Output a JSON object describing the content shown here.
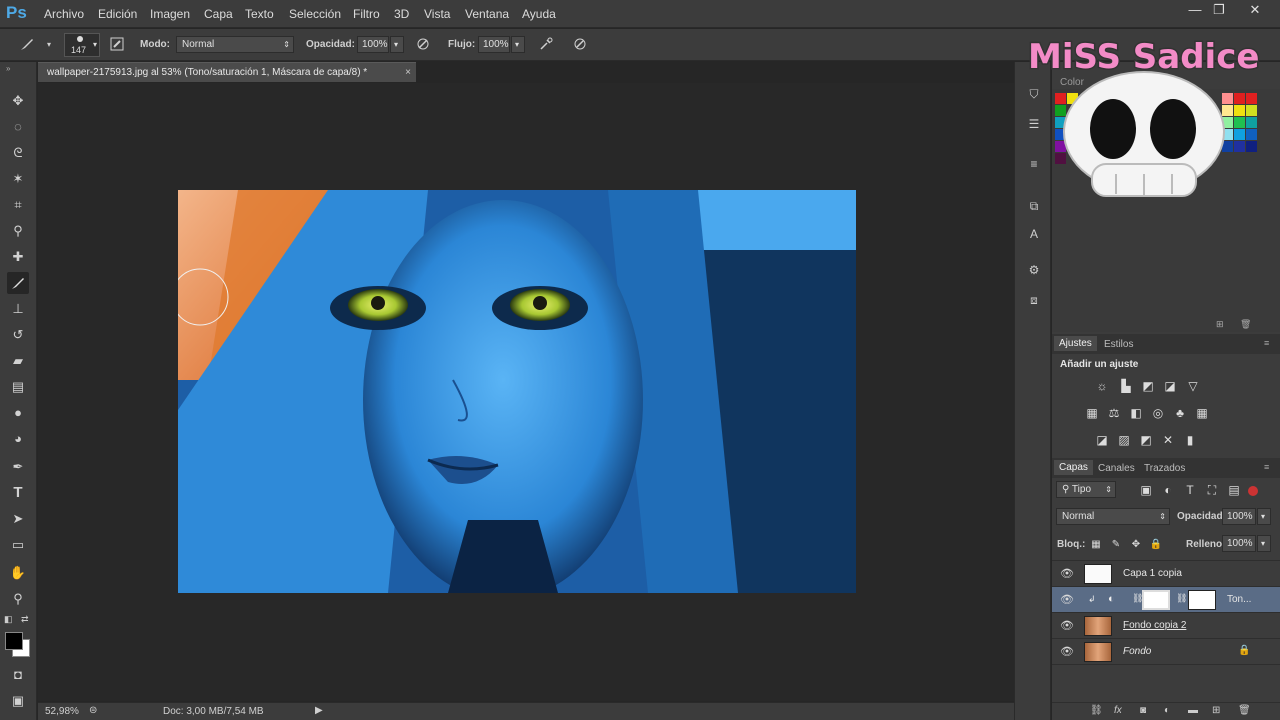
{
  "app": {
    "logo": "Ps"
  },
  "menu": [
    "Archivo",
    "Edición",
    "Imagen",
    "Capa",
    "Texto",
    "Selección",
    "Filtro",
    "3D",
    "Vista",
    "Ventana",
    "Ayuda"
  ],
  "window_controls": [
    "—",
    "❐",
    "✕"
  ],
  "options": {
    "brush_size": "147",
    "mode_label": "Modo:",
    "mode_value": "Normal",
    "opacity_label": "Opacidad:",
    "opacity_value": "100%",
    "flow_label": "Flujo:",
    "flow_value": "100%"
  },
  "document": {
    "tab_title": "wallpaper-2175913.jpg al 53% (Tono/saturación 1, Máscara de capa/8) *",
    "close": "×"
  },
  "status": {
    "zoom": "52,98%",
    "doc_size": "Doc: 3,00 MB/7,54 MB"
  },
  "watermark": {
    "text": "MiSS Sadice"
  },
  "panels": {
    "color_tab": "Color",
    "adjust_tabs": [
      "Ajustes",
      "Estilos"
    ],
    "adjust_heading": "Añadir un ajuste",
    "layer_tabs": [
      "Capas",
      "Canales",
      "Trazados"
    ],
    "filter_kind": "Tipo",
    "blend_mode": "Normal",
    "opacity_label": "Opacidad:",
    "opacity_value": "100%",
    "lock_label": "Bloq.:",
    "fill_label": "Relleno:",
    "fill_value": "100%",
    "layers": [
      {
        "name": "Capa 1 copia",
        "thumb": "white",
        "selected": false
      },
      {
        "name": "Ton...",
        "thumb": "adjustment",
        "selected": true
      },
      {
        "name": "Fondo copia 2",
        "thumb": "photo",
        "selected": false
      },
      {
        "name": "Fondo",
        "thumb": "photo",
        "selected": false,
        "locked": true
      }
    ]
  },
  "colors": {
    "ui_bg": "#3c3c3c",
    "canvas_bg": "#282828",
    "selected_layer": "#5a6c86",
    "ps_blue": "#4ea9e6",
    "image_blue": "#2a7fd0",
    "eye_green": "#b8d23a",
    "hair_orange": "#e0742a"
  }
}
